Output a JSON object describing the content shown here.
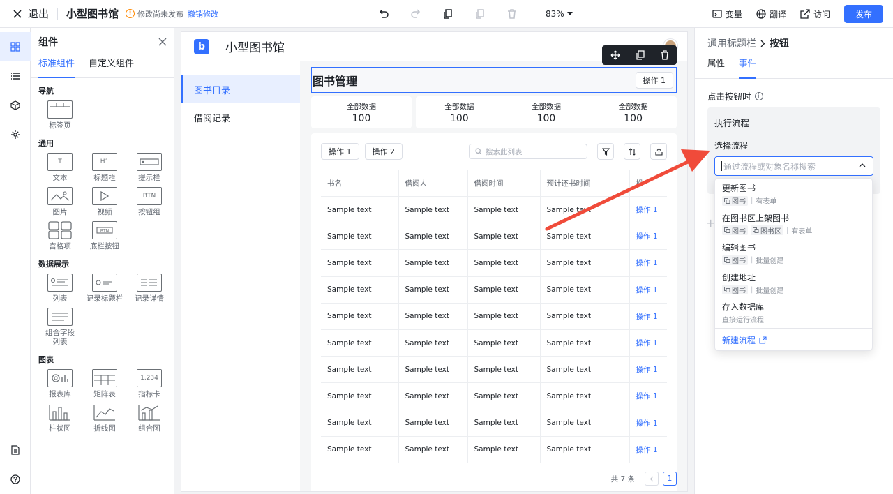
{
  "topbar": {
    "exit_label": "退出",
    "app_name": "小型图书馆",
    "unpublished_text": "修改尚未发布",
    "undo_changes_label": "撤销修改",
    "zoom": "83%",
    "variables_label": "变量",
    "translate_label": "翻译",
    "visit_label": "访问",
    "publish_label": "发布"
  },
  "components_panel": {
    "title": "组件",
    "tabs": [
      "标准组件",
      "自定义组件"
    ],
    "sections": [
      {
        "title": "导航",
        "items": [
          "标签页"
        ]
      },
      {
        "title": "通用",
        "items": [
          "文本",
          "标题栏",
          "提示栏",
          "图片",
          "视频",
          "按钮组",
          "宫格项",
          "底栏按钮"
        ]
      },
      {
        "title": "数据展示",
        "items": [
          "列表",
          "记录标题栏",
          "记录详情",
          "组合字段\n列表"
        ]
      },
      {
        "title": "图表",
        "items": [
          "报表库",
          "矩阵表",
          "指标卡",
          "柱状图",
          "折线图",
          "组合图"
        ]
      }
    ]
  },
  "canvas": {
    "app_name": "小型图书馆",
    "nav": [
      "图书目录",
      "借阅记录"
    ],
    "page_title": "图书管理",
    "title_action": "操作 1",
    "stats": [
      {
        "label": "全部数据",
        "value": "100"
      },
      {
        "label": "全部数据",
        "value": "100"
      },
      {
        "label": "全部数据",
        "value": "100"
      },
      {
        "label": "全部数据",
        "value": "100"
      }
    ],
    "list_actions": [
      "操作 1",
      "操作 2"
    ],
    "search_placeholder": "搜索此列表",
    "table": {
      "headers": [
        "书名",
        "借阅人",
        "借阅时间",
        "预计还书时间",
        "操"
      ],
      "rows": [
        [
          "Sample text",
          "Sample text",
          "Sample text",
          "Sample text",
          "操作 1"
        ],
        [
          "Sample text",
          "Sample text",
          "Sample text",
          "Sample text",
          "操作 1"
        ],
        [
          "Sample text",
          "Sample text",
          "Sample text",
          "Sample text",
          "操作 1"
        ],
        [
          "Sample text",
          "Sample text",
          "Sample text",
          "Sample text",
          "操作 1"
        ],
        [
          "Sample text",
          "Sample text",
          "Sample text",
          "Sample text",
          "操作 1"
        ],
        [
          "Sample text",
          "Sample text",
          "Sample text",
          "Sample text",
          "操作 1"
        ],
        [
          "Sample text",
          "Sample text",
          "Sample text",
          "Sample text",
          "操作 1"
        ],
        [
          "Sample text",
          "Sample text",
          "Sample text",
          "Sample text",
          "操作 1"
        ],
        [
          "Sample text",
          "Sample text",
          "Sample text",
          "Sample text",
          "操作 1"
        ],
        [
          "Sample text",
          "Sample text",
          "Sample text",
          "Sample text",
          "操作 1"
        ]
      ]
    },
    "total_text": "共 7 条",
    "current_page": "1"
  },
  "props_panel": {
    "breadcrumb_parent": "通用标题栏",
    "breadcrumb_current": "按钮",
    "tabs": [
      "属性",
      "事件"
    ],
    "event_label": "点击按钮时",
    "flow_title": "执行流程",
    "select_label": "选择流程",
    "select_placeholder": "通过流程或对象名称搜索"
  },
  "dropdown": {
    "options": [
      {
        "name": "更新图书",
        "tags": [
          "图书"
        ],
        "note": "有表单"
      },
      {
        "name": "在图书区上架图书",
        "tags": [
          "图书",
          "图书区"
        ],
        "note": "有表单"
      },
      {
        "name": "编辑图书",
        "tags": [
          "图书"
        ],
        "note": "批量创建"
      },
      {
        "name": "创建地址",
        "tags": [
          "图书"
        ],
        "note": "批量创建"
      },
      {
        "name": "存入数据库",
        "tags": [],
        "note": "直接运行流程"
      }
    ],
    "new_flow_label": "新建流程"
  },
  "colors": {
    "accent": "#3370ff",
    "warning": "#ff8800",
    "annotation_arrow": "#f04b3a"
  }
}
